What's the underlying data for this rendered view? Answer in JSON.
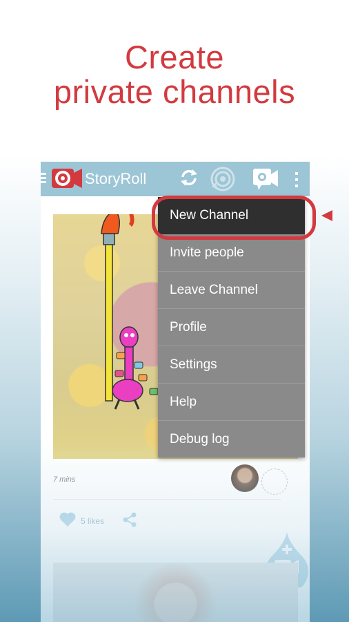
{
  "headline": {
    "line1": "Create",
    "line2": "private channels"
  },
  "app": {
    "title": "StoryRoll"
  },
  "post": {
    "time": "7 mins",
    "likes_count": "5",
    "likes_label": "likes"
  },
  "menu": {
    "items": [
      {
        "label": "New Channel",
        "active": true
      },
      {
        "label": "Invite people"
      },
      {
        "label": "Leave Channel"
      },
      {
        "label": "Profile"
      },
      {
        "label": "Settings"
      },
      {
        "label": "Help"
      },
      {
        "label": "Debug log"
      }
    ]
  },
  "colors": {
    "accent": "#d23a3f",
    "appbar": "#9cc5d6",
    "menu_bg": "#8a8a8a",
    "menu_active": "#2f2f2f"
  },
  "icons": [
    "menu-icon",
    "storyroll-logo-icon",
    "refresh-icon",
    "channels-icon",
    "video-camera-icon",
    "overflow-menu-icon",
    "heart-icon",
    "share-icon",
    "add-video-icon"
  ]
}
